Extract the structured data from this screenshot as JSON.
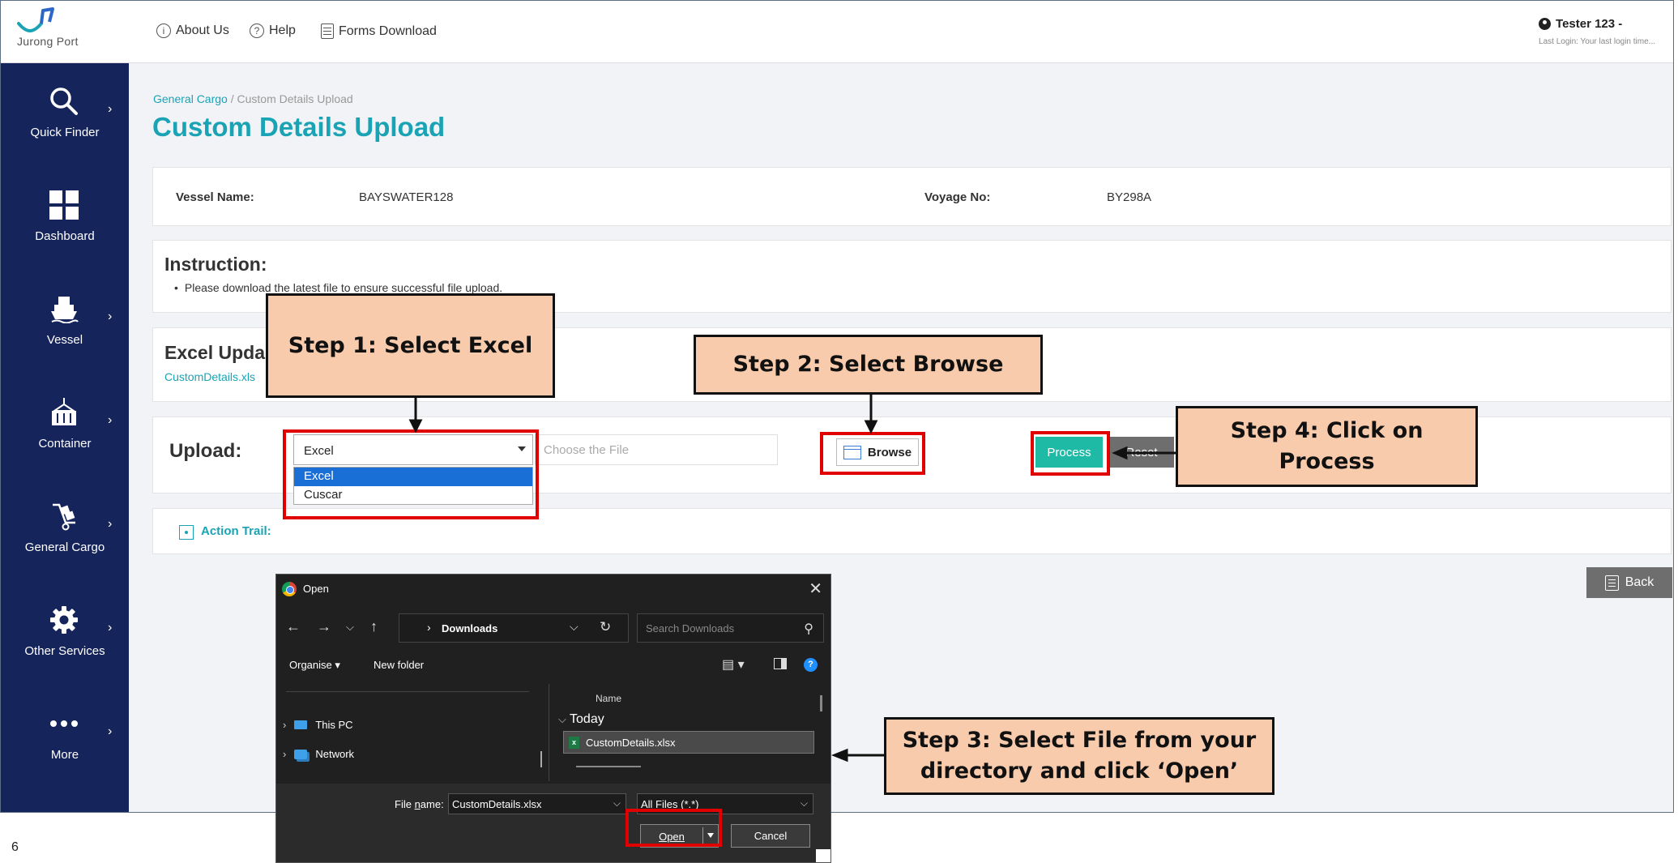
{
  "header": {
    "logo_text": "Jurong Port",
    "about_label": "About Us",
    "help_label": "Help",
    "forms_label": "Forms Download",
    "user_name": "Tester 123 -",
    "last_login": "Last Login: Your last login time..."
  },
  "sidebar": {
    "items": [
      {
        "label": "Quick Finder",
        "icon": "search-icon"
      },
      {
        "label": "Dashboard",
        "icon": "dashboard-icon"
      },
      {
        "label": "Vessel",
        "icon": "vessel-icon"
      },
      {
        "label": "Container",
        "icon": "container-icon"
      },
      {
        "label": "General Cargo",
        "icon": "cargo-icon"
      },
      {
        "label": "Other Services",
        "icon": "gear-icon"
      },
      {
        "label": "More",
        "icon": "more-icon"
      }
    ]
  },
  "breadcrumb": {
    "parent": "General Cargo",
    "separator": " / ",
    "current": "Custom Details Upload"
  },
  "page_title": "Custom Details Upload",
  "vessel": {
    "name_label": "Vessel Name:",
    "name_value": "BAYSWATER128",
    "voyage_label": "Voyage No:",
    "voyage_value": "BY298A"
  },
  "instruction": {
    "title": "Instruction:",
    "line": "Please download the latest file to ensure successful file upload."
  },
  "excel_update": {
    "title": "Excel Upda",
    "file_link": "CustomDetails.xls"
  },
  "upload": {
    "label": "Upload:",
    "selected_type": "Excel",
    "options": [
      "Excel",
      "Cuscar"
    ],
    "file_placeholder": "Choose the File",
    "browse_label": "Browse",
    "process_label": "Process",
    "reset_label": "Reset"
  },
  "action_trail": {
    "label": "Action Trail:"
  },
  "back_label": "Back",
  "dialog": {
    "title": "Open",
    "address": "Downloads",
    "search_placeholder": "Search Downloads",
    "organise_label": "Organise ▾",
    "new_folder_label": "New folder",
    "nav_items": [
      "This PC",
      "Network"
    ],
    "column_name": "Name",
    "group_label": "Today",
    "file_name": "CustomDetails.xlsx",
    "file_name_label_pre": "File ",
    "file_name_label_key": "n",
    "file_name_label_post": "ame:",
    "file_name_value": "CustomDetails.xlsx",
    "file_type_value": "All Files (*.*)",
    "open_label": "Open",
    "cancel_label": "Cancel"
  },
  "callouts": {
    "step1": "Step 1: Select Excel",
    "step2": "Step 2: Select Browse",
    "step3_line1": "Step 3: Select File from your",
    "step3_line2": "directory and click ‘Open’",
    "step4_line1": "Step 4: Click on",
    "step4_line2": "Process"
  },
  "page_number": "6",
  "colors": {
    "sidebar_bg": "#15245a",
    "accent_teal": "#1aa3b4",
    "process_green": "#1fbaa6",
    "highlight_red": "#e00000",
    "callout_fill": "#f8cbad",
    "dialog_bg": "#202020"
  }
}
